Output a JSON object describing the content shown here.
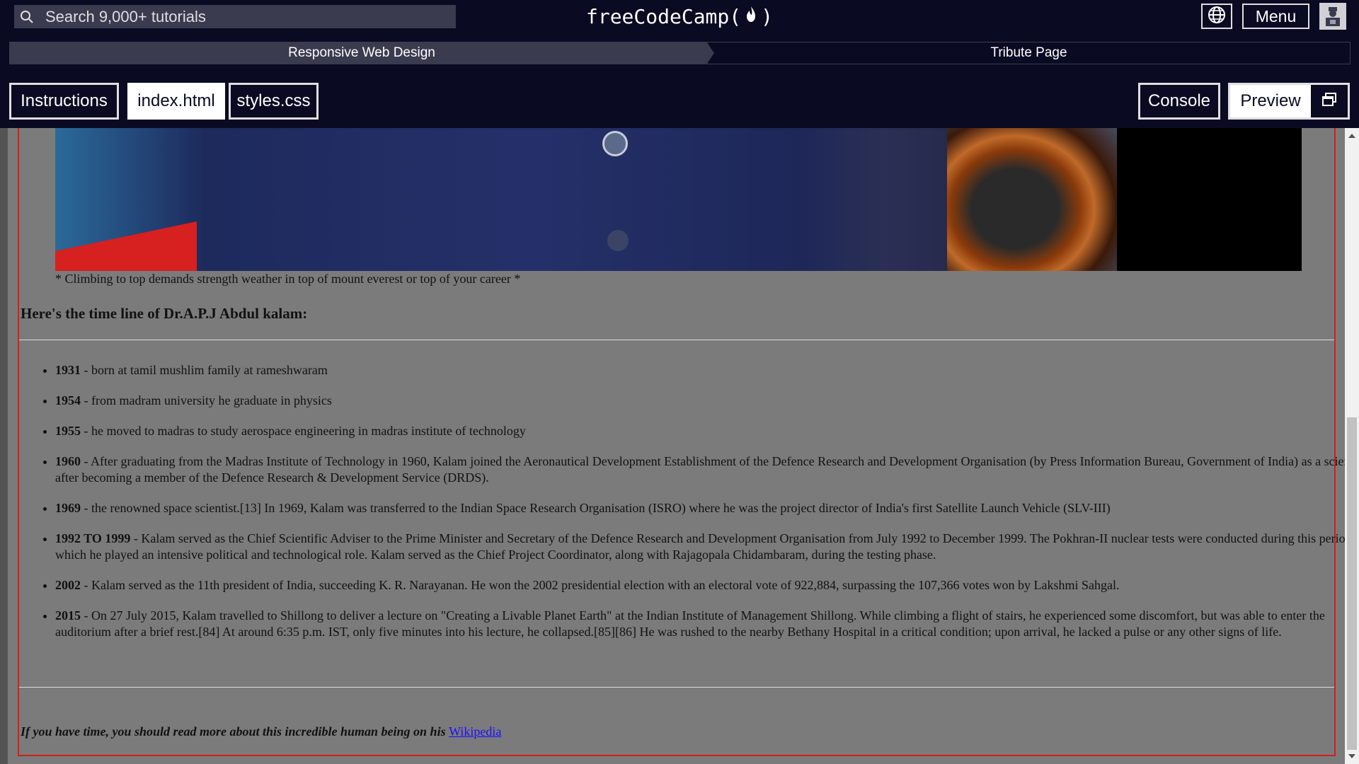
{
  "header": {
    "search_placeholder": "Search 9,000+ tutorials",
    "logo_text_left": "freeCodeCamp(",
    "logo_text_right": ")",
    "menu_label": "Menu"
  },
  "breadcrumb": {
    "course": "Responsive Web Design",
    "project": "Tribute Page"
  },
  "tabs": {
    "instructions": "Instructions",
    "index_html": "index.html",
    "styles_css": "styles.css",
    "console": "Console",
    "preview": "Preview"
  },
  "preview_page": {
    "caption": "* Climbing to top demands strength weather in top of mount everest or top of your career *",
    "timeline_title": "Here's the time line of Dr.A.P.J Abdul kalam:",
    "events": [
      {
        "year": "1931",
        "text": " - born at tamil mushlim family at rameshwaram"
      },
      {
        "year": "1954",
        "text": " - from madram university he graduate in physics"
      },
      {
        "year": "1955",
        "text": " - he moved to madras to study aerospace engineering in madras institute of technology"
      },
      {
        "year": "1960",
        "text": " - After graduating from the Madras Institute of Technology in 1960, Kalam joined the Aeronautical Development Establishment of the Defence Research and Development Organisation (by Press Information Bureau, Government of India) as a scientist after becoming a member of the Defence Research & Development Service (DRDS)."
      },
      {
        "year": "1969",
        "text": " - the renowned space scientist.[13] In 1969, Kalam was transferred to the Indian Space Research Organisation (ISRO) where he was the project director of India's first Satellite Launch Vehicle (SLV-III)"
      },
      {
        "year": "1992 TO 1999",
        "text": " - Kalam served as the Chief Scientific Adviser to the Prime Minister and Secretary of the Defence Research and Development Organisation from July 1992 to December 1999. The Pokhran-II nuclear tests were conducted during this period in which he played an intensive political and technological role. Kalam served as the Chief Project Coordinator, along with Rajagopala Chidambaram, during the testing phase."
      },
      {
        "year": "2002",
        "text": " - Kalam served as the 11th president of India, succeeding K. R. Narayanan. He won the 2002 presidential election with an electoral vote of 922,884, surpassing the 107,366 votes won by Lakshmi Sahgal."
      },
      {
        "year": "2015",
        "text": " - On 27 July 2015, Kalam travelled to Shillong to deliver a lecture on \"Creating a Livable Planet Earth\" at the Indian Institute of Management Shillong. While climbing a flight of stairs, he experienced some discomfort, but was able to enter the auditorium after a brief rest.[84] At around 6:35 p.m. IST, only five minutes into his lecture, he collapsed.[85][86] He was rushed to the nearby Bethany Hospital in a critical condition; upon arrival, he lacked a pulse or any other signs of life."
      }
    ],
    "footer_text": "If you have time, you should read more about this incredible human being on his ",
    "footer_link": "Wikipedia"
  },
  "colors": {
    "nav_bg": "#0a0a23",
    "crumb_bg": "#3b3b4f",
    "preview_bg": "#7b7b7b",
    "page_border": "#d21f1f",
    "link": "#1a0dff"
  },
  "icons": [
    "search-icon",
    "flame-icon",
    "globe-icon",
    "user-avatar-icon",
    "preview-popout-icon",
    "scroll-up-icon",
    "scroll-down-icon"
  ]
}
